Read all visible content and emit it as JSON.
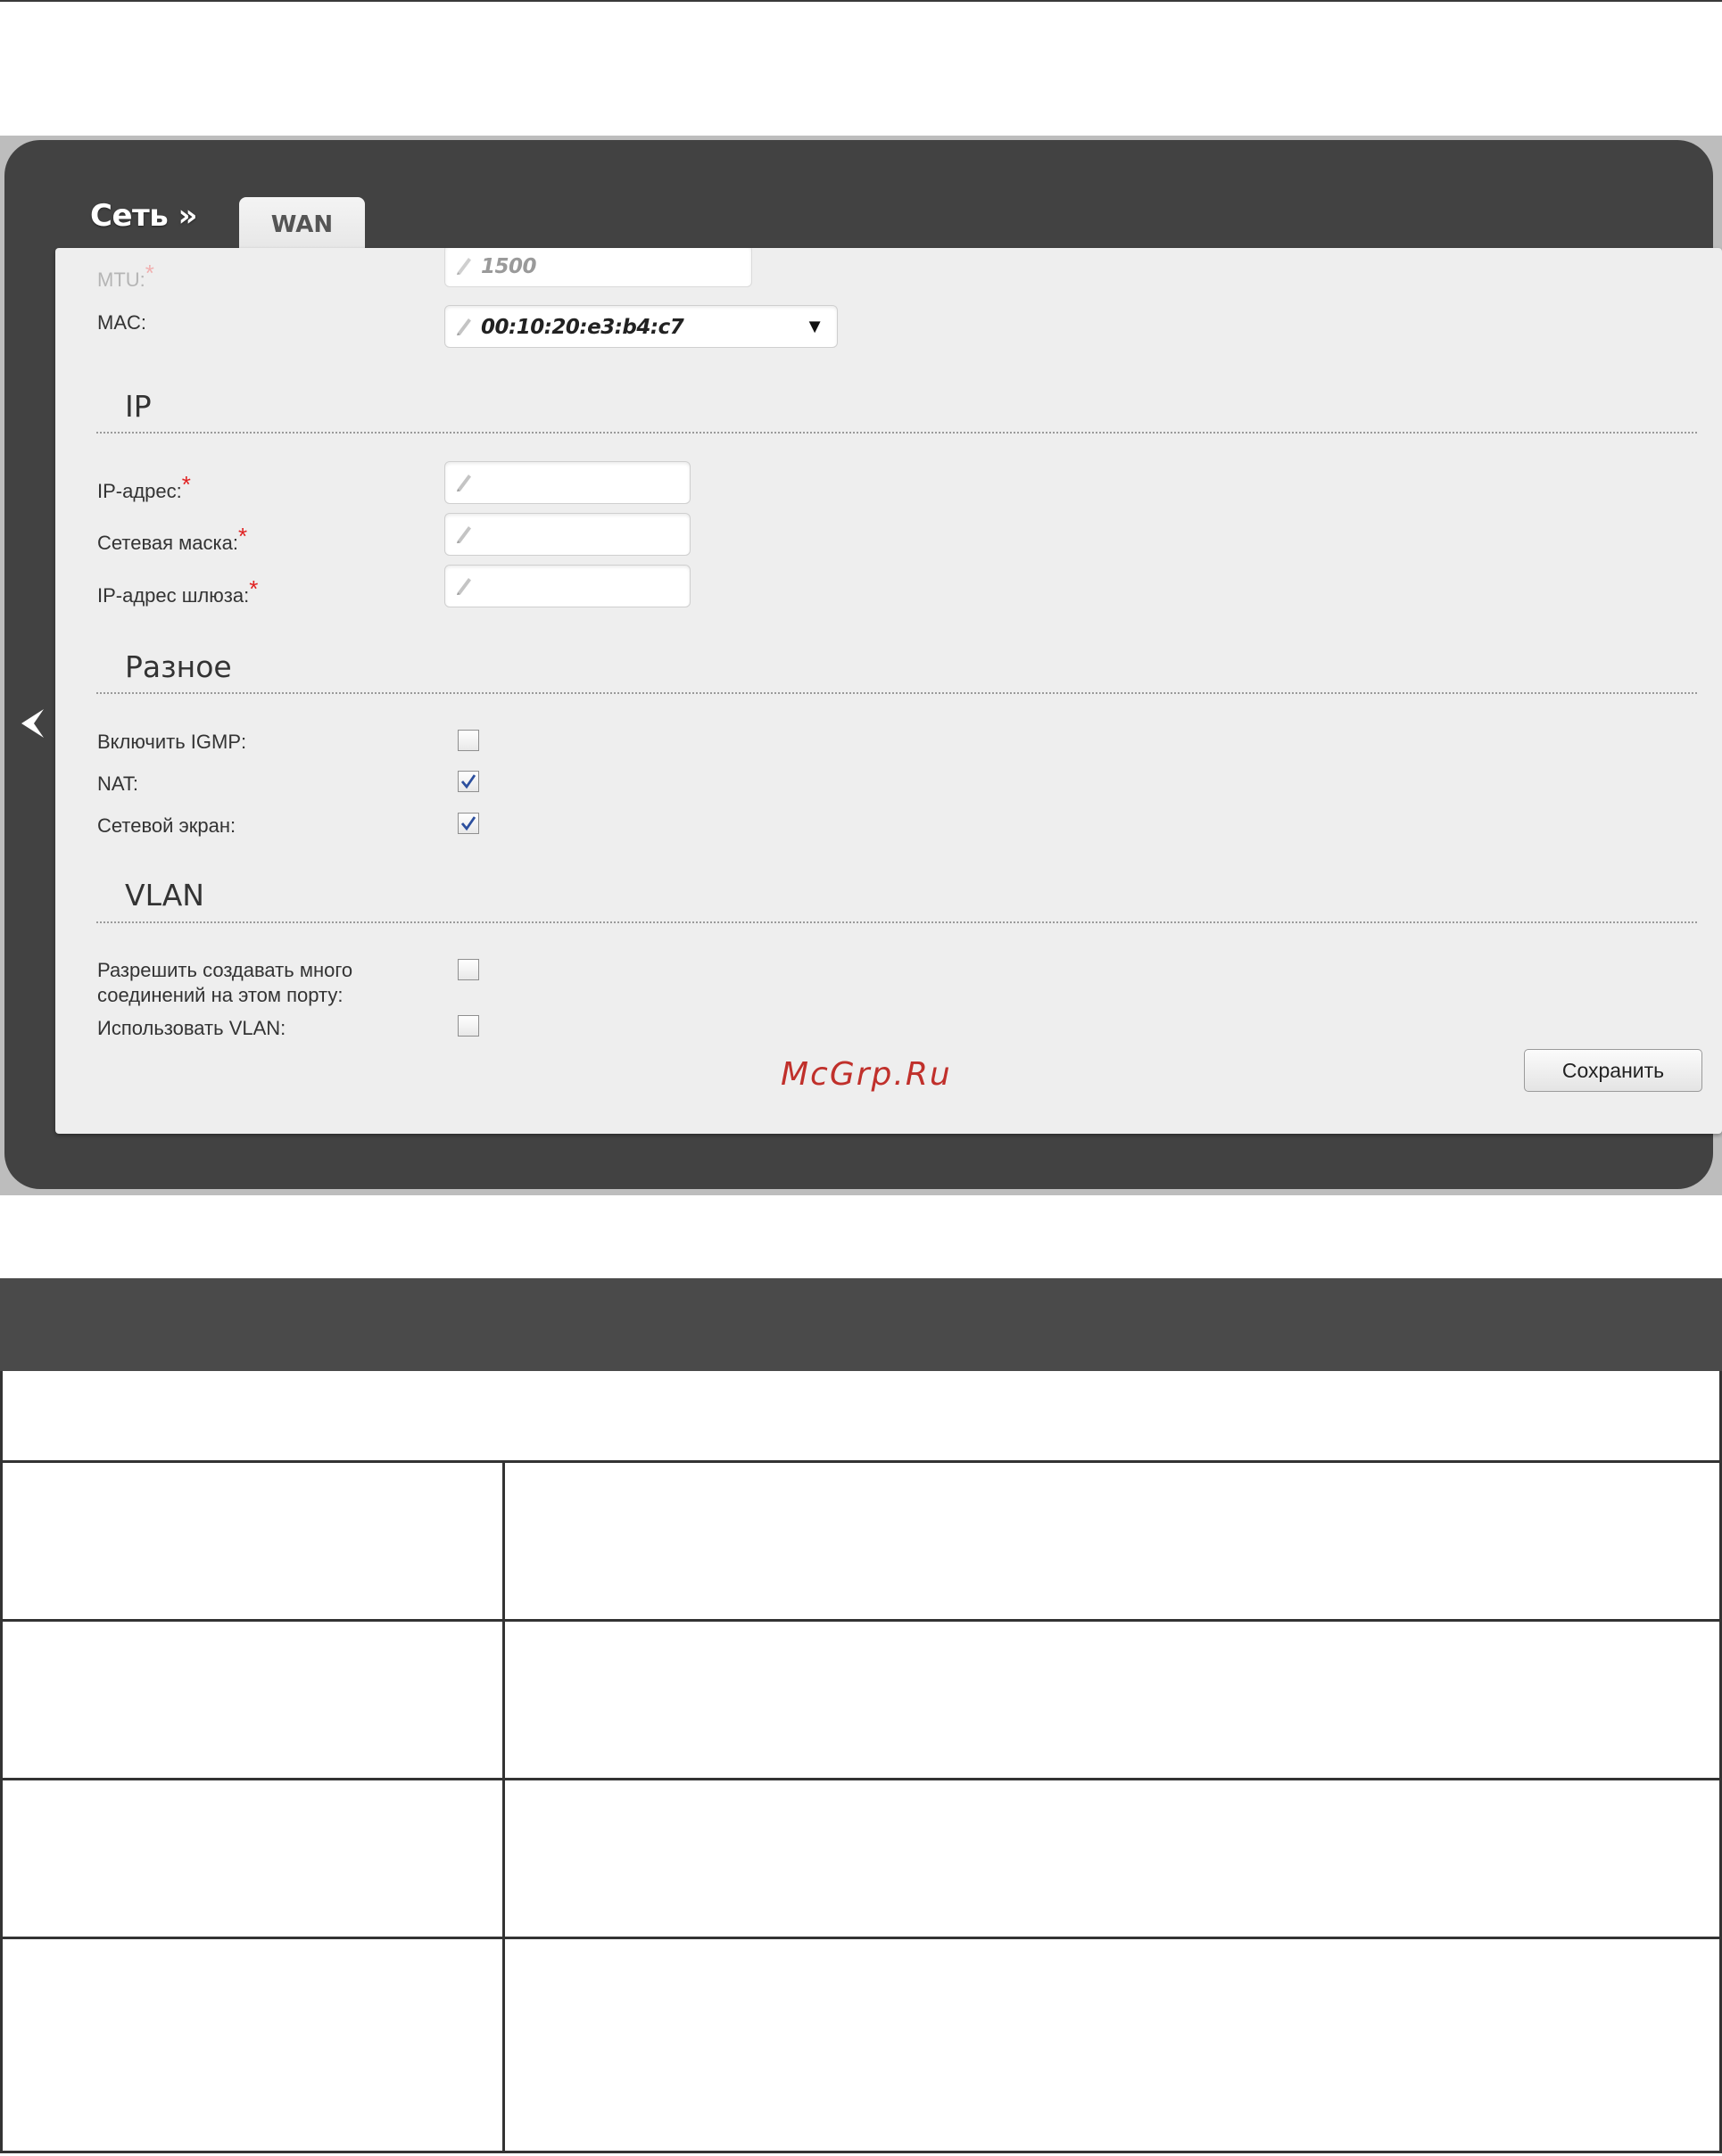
{
  "page": {
    "screen": {
      "section_title": "Сеть »",
      "active_tab": "WAN",
      "fields": {
        "mtu": {
          "label": "MTU:",
          "required_mark": "*",
          "value": "1500"
        },
        "mac": {
          "label": "MAC:",
          "value": "00:10:20:e3:b4:c7",
          "caret": "▼"
        }
      },
      "groups": {
        "ip": {
          "title": "IP",
          "ip_address": {
            "label": "IP-адрес:",
            "required_mark": "*",
            "value": ""
          },
          "netmask": {
            "label": "Сетевая маска:",
            "required_mark": "*",
            "value": ""
          },
          "gateway": {
            "label": "IP-адрес шлюза:",
            "required_mark": "*",
            "value": ""
          }
        },
        "misc": {
          "title": "Разное",
          "igmp": {
            "label": "Включить IGMP:",
            "checked": false
          },
          "nat": {
            "label": "NAT:",
            "checked": true
          },
          "firewall": {
            "label": "Сетевой экран:",
            "checked": true
          }
        },
        "vlan": {
          "title": "VLAN",
          "multi_conn": {
            "label_line1": "Разрешить создавать много",
            "label_line2": "соединений на этом порту:",
            "checked": false
          },
          "use_vlan": {
            "label": "Использовать VLAN:",
            "checked": false
          }
        }
      },
      "watermark": "McGrp.Ru",
      "save_button": "Сохранить"
    },
    "table": {
      "header": "",
      "span_row": "",
      "rows": [
        {
          "param": "",
          "description": ""
        },
        {
          "param": "",
          "description": ""
        },
        {
          "param": "",
          "description": ""
        },
        {
          "param": "",
          "description": ""
        }
      ]
    }
  },
  "colors": {
    "device_bg": "#424242",
    "panel_bg": "#eeeeee",
    "required": "#e02020",
    "watermark": "#c0302b",
    "table_header": "#4a4a4a"
  },
  "icons": {
    "back": "chevron-left-icon",
    "edit": "pencil-icon",
    "check": "check-icon",
    "dropdown": "caret-down-icon"
  }
}
